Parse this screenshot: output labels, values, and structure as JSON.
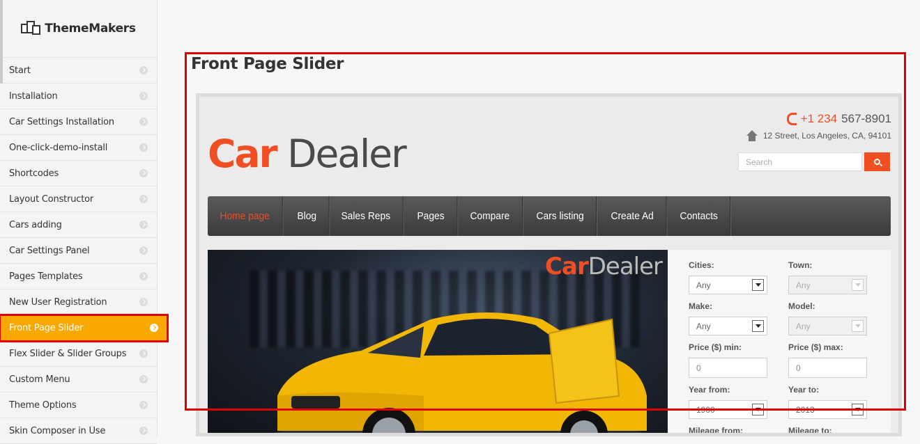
{
  "sidebar": {
    "brand": "ThemeMakers",
    "items": [
      {
        "label": "Start"
      },
      {
        "label": "Installation"
      },
      {
        "label": "Car Settings Installation"
      },
      {
        "label": "One-click-demo-install"
      },
      {
        "label": "Shortcodes"
      },
      {
        "label": "Layout Constructor"
      },
      {
        "label": "Cars adding"
      },
      {
        "label": "Car Settings Panel"
      },
      {
        "label": "Pages Templates"
      },
      {
        "label": "New User Registration"
      },
      {
        "label": "Front Page Slider",
        "active": true
      },
      {
        "label": "Flex Slider & Slider Groups"
      },
      {
        "label": "Custom Menu"
      },
      {
        "label": "Theme Options"
      },
      {
        "label": "Skin Composer in Use"
      }
    ]
  },
  "main": {
    "title": "Front Page Slider"
  },
  "preview": {
    "logo_a": "Car",
    "logo_b": "Dealer",
    "phone_accent": "+1 234",
    "phone_rest": "567-8901",
    "address": "12 Street, Los Angeles, CA, 94101",
    "search_placeholder": "Search",
    "menu": [
      "Home page",
      "Blog",
      "Sales Reps",
      "Pages",
      "Compare",
      "Cars listing",
      "Create Ad",
      "Contacts"
    ],
    "watermark_a": "Car",
    "watermark_b": "Dealer",
    "filter": {
      "cities_label": "Cities:",
      "cities_value": "Any",
      "town_label": "Town:",
      "town_value": "Any",
      "make_label": "Make:",
      "make_value": "Any",
      "model_label": "Model:",
      "model_value": "Any",
      "price_min_label": "Price ($) min:",
      "price_min_value": "0",
      "price_max_label": "Price ($) max:",
      "price_max_value": "0",
      "year_from_label": "Year from:",
      "year_from_value": "1900",
      "year_to_label": "Year to:",
      "year_to_value": "2013",
      "mileage_from_label": "Mileage from:",
      "mileage_to_label": "Mileage to:"
    }
  },
  "colors": {
    "accent": "#f04e23",
    "active_item": "#f9a800",
    "highlight": "#e00000"
  }
}
